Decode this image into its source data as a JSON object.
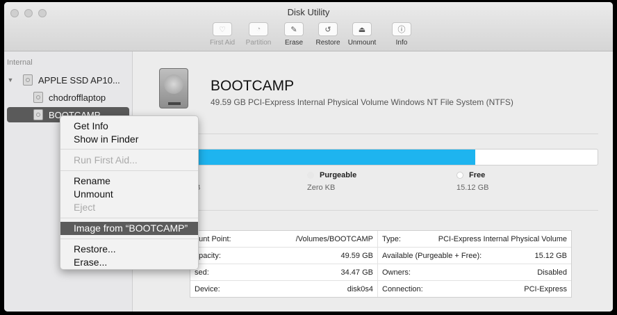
{
  "window": {
    "title": "Disk Utility"
  },
  "toolbar": {
    "first_aid": "First Aid",
    "partition": "Partition",
    "erase": "Erase",
    "restore": "Restore",
    "unmount": "Unmount",
    "info": "Info"
  },
  "sidebar": {
    "section": "Internal",
    "items": [
      {
        "label": "APPLE SSD AP10..."
      },
      {
        "label": "chodrofflaptop"
      },
      {
        "label": "BOOTCAMP"
      }
    ]
  },
  "volume": {
    "name": "BOOTCAMP",
    "description": "49.59 GB PCI-Express Internal Physical Volume Windows NT File System (NTFS)"
  },
  "usage": {
    "used_fraction": 0.695,
    "used_value_partial": "B",
    "purgeable_label": "Purgeable",
    "purgeable_value": "Zero KB",
    "free_label": "Free",
    "free_value": "15.12 GB",
    "colors": {
      "used": "#1eb4ef",
      "free": "#ffffff"
    }
  },
  "info": {
    "rows": [
      {
        "label_a": "ount Point:",
        "value_a": "/Volumes/BOOTCAMP",
        "label_b": "Type:",
        "value_b": "PCI-Express Internal Physical Volume"
      },
      {
        "label_a": "apacity:",
        "value_a": "49.59 GB",
        "label_b": "Available (Purgeable + Free):",
        "value_b": "15.12 GB"
      },
      {
        "label_a": "sed:",
        "value_a": "34.47 GB",
        "label_b": "Owners:",
        "value_b": "Disabled"
      },
      {
        "label_a": "Device:",
        "value_a": "disk0s4",
        "label_b": "Connection:",
        "value_b": "PCI-Express"
      }
    ]
  },
  "context_menu": {
    "get_info": "Get Info",
    "show_in_finder": "Show in Finder",
    "run_first_aid": "Run First Aid...",
    "rename": "Rename",
    "unmount": "Unmount",
    "eject": "Eject",
    "image_from": "Image from “BOOTCAMP”",
    "restore": "Restore...",
    "erase": "Erase..."
  }
}
